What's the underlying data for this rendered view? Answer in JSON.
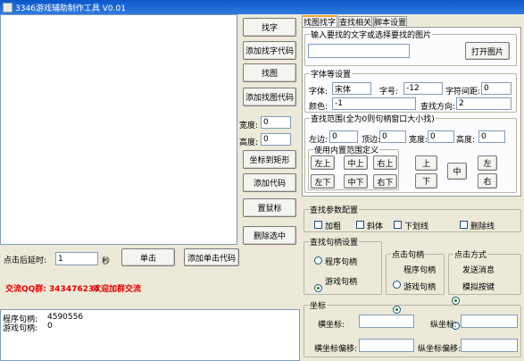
{
  "window": {
    "title": "3346游戏辅助制作工具 V0.01"
  },
  "middle_buttons": {
    "find_text": "找字",
    "add_find_text_code": "添加找字代码",
    "find_image": "找图",
    "add_find_image_code": "添加找图代码",
    "width_label": "宽度:",
    "width_value": "0",
    "height_label": "高度:",
    "height_value": "0",
    "coord_to_rect": "坐标到矩形",
    "add_code": "添加代码",
    "set_mouse": "置鼠标",
    "delete_selected": "删除选中"
  },
  "click_row": {
    "delay_label": "点击后延时:",
    "delay_value": "1",
    "unit": "秒",
    "click_button": "单击",
    "add_click_code": "添加单击代码"
  },
  "promo": {
    "qq_group": "交流QQ群: 343476234",
    "welcome": "欢迎加群交流"
  },
  "handles": {
    "program_label": "程序句柄:",
    "program_value": "4590556",
    "game_label": "游戏句柄:",
    "game_value": "0"
  },
  "tabs": [
    {
      "label": "找图找字",
      "active": true
    },
    {
      "label": "查找相关",
      "active": false
    },
    {
      "label": "脚本设置",
      "active": false
    }
  ],
  "search_input": {
    "group_label": "输入要找的文字或选择要找的图片",
    "value": "",
    "open_image_button": "打开图片"
  },
  "font_settings": {
    "group_label": "字体等设置",
    "font_label": "字体:",
    "font_value": "宋体",
    "size_label": "字号:",
    "size_value": "-12",
    "spacing_label": "字符间距:",
    "spacing_value": "0",
    "color_label": "颜色:",
    "color_value": "-1",
    "direction_label": "查找方向:",
    "direction_value": "2"
  },
  "search_range": {
    "group_label": "查找范围(全为0则句柄窗口大小找)",
    "left_label": "左边:",
    "left_value": "0",
    "top_label": "顶边:",
    "top_value": "0",
    "width_label": "宽度:",
    "width_value": "0",
    "height_label": "高度:",
    "height_value": "0",
    "builtin_label": "使用内置范围定义",
    "top_left": "左上",
    "middle_top": "中上",
    "top_right": "右上",
    "bottom_left": "左下",
    "middle_bottom": "中下",
    "bottom_right": "右下",
    "up": "上",
    "down": "下",
    "center": "中",
    "left": "左",
    "right": "右"
  },
  "find_params": {
    "group_label": "查找参数配置",
    "bold": "加粗",
    "italic": "斜体",
    "underline": "下划线",
    "strikethrough": "删除线"
  },
  "find_handle": {
    "group_label": "查找句柄设置",
    "program_handle": "程序句柄",
    "game_handle": "游戏句柄",
    "selected": "游戏句柄"
  },
  "click_handle": {
    "group_label": "点击句柄",
    "program_handle": "程序句柄",
    "game_handle": "游戏句柄",
    "selected": "游戏句柄"
  },
  "click_mode": {
    "group_label": "点击方式",
    "send_message": "发送消息",
    "simulate_keys": "模拟按键",
    "selected": "发送消息"
  },
  "coords": {
    "group_label": "坐标",
    "x_label": "横坐标:",
    "x_value": "",
    "y_label": "纵坐标:",
    "y_value": "",
    "x_offset_label": "横坐标偏移:",
    "x_offset_value": "",
    "y_offset_label": "纵坐标偏移:",
    "y_offset_value": ""
  }
}
